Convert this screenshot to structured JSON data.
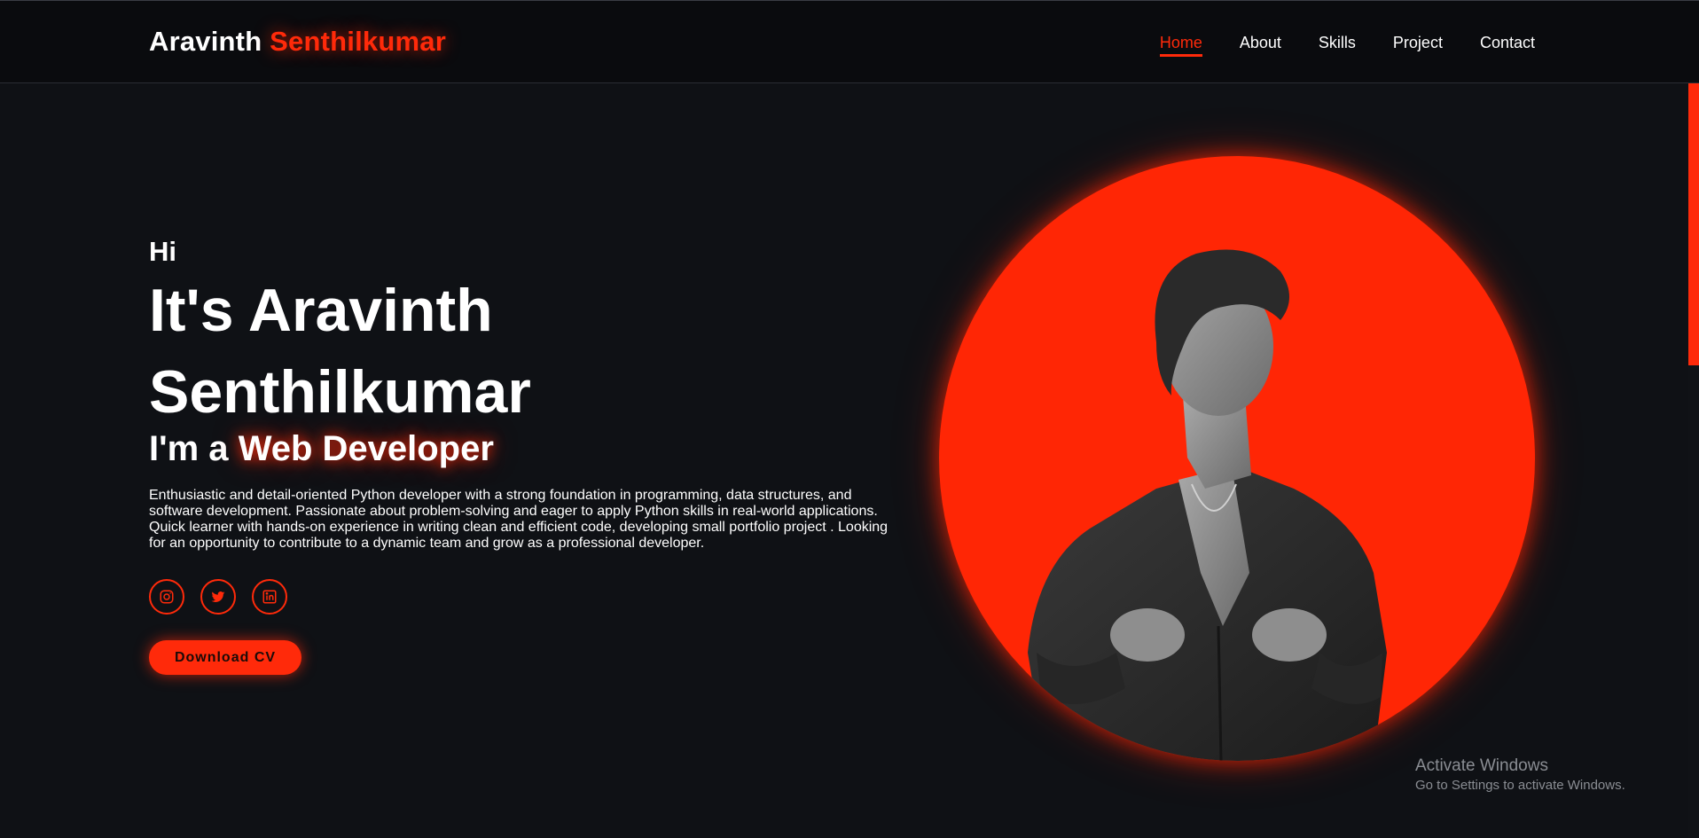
{
  "header": {
    "logo_first": "Aravinth",
    "logo_last": "Senthilkumar",
    "nav": [
      "Home",
      "About",
      "Skills",
      "Project",
      "Contact"
    ]
  },
  "hero": {
    "greeting": "Hi",
    "name_line1": "It's Aravinth",
    "name_line2": "Senthilkumar",
    "role_prefix": "I'm a",
    "role_title": "Web Developer",
    "bio": "Enthusiastic and detail-oriented Python developer with a strong foundation in programming, data structures, and software development. Passionate about problem-solving and eager to apply Python skills in real-world applications. Quick learner with hands-on experience in writing clean and efficient code, developing small portfolio project . Looking for an opportunity to contribute to a dynamic team and grow as a professional developer.",
    "socials": [
      "instagram-icon",
      "twitter-icon",
      "linkedin-icon"
    ],
    "cv_button": "Download CV"
  },
  "watermark": {
    "title": "Activate Windows",
    "subtitle": "Go to Settings to activate Windows."
  },
  "colors": {
    "accent": "#ff2a0a",
    "background": "#0f1115",
    "header_bg": "#0a0b0e"
  }
}
